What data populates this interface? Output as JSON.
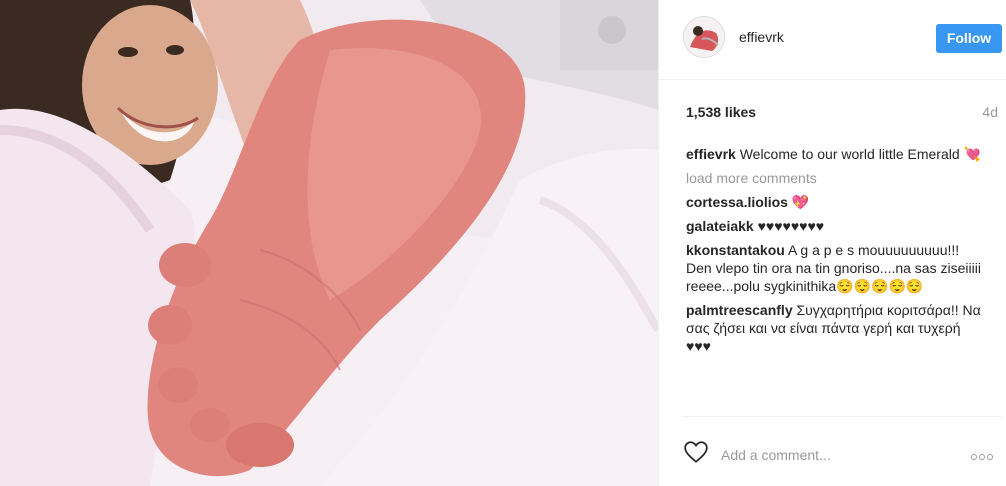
{
  "post": {
    "username": "effievrk",
    "follow_label": "Follow",
    "likes": "1,538 likes",
    "time": "4d",
    "caption_text": "Welcome to our world little Emerald 💘",
    "load_more": "load more comments",
    "comments": [
      {
        "author": "cortessa.liolios",
        "text": "💖"
      },
      {
        "author": "galateiakk",
        "text": "♥♥♥♥♥♥♥♥"
      },
      {
        "author": "kkonstantakou",
        "text": "A g a p e s mouuuuuuuuu!!! Den vlepo tin ora na tin gnoriso....na sas zisei­iiii reeee...polu sygkinithika😌😌😌😌😌"
      },
      {
        "author": "palmtreescanfly",
        "text": "Συγχαρητήρια κοριτσάρα!! Να σας ζήσει και να είναι πάντα γερή και τυχερή ♥♥♥"
      }
    ],
    "add_comment_placeholder": "Add a comment...",
    "colors": {
      "follow_bg": "#3897f0",
      "muted": "#999999",
      "text": "#262626"
    },
    "icons": {
      "like": "heart-outline-icon",
      "more": "more-options-icon"
    }
  }
}
